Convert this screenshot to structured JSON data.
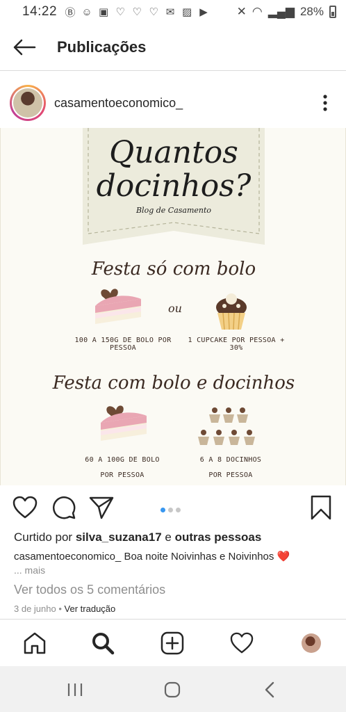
{
  "status_bar": {
    "time": "14:22",
    "battery": "28%",
    "icons": [
      "b-icon",
      "chat-icon",
      "facebook-icon",
      "heart-icon",
      "heart-icon",
      "heart-icon",
      "mail-icon",
      "image-icon",
      "youtube-icon"
    ]
  },
  "header": {
    "title": "Publicações"
  },
  "post": {
    "username": "casamentoeconomico_",
    "image": {
      "title_line1": "Quantos",
      "title_line2": "docinhos?",
      "subtitle": "Blog de Casamento",
      "section1_title": "Festa só com bolo",
      "or_label": "ou",
      "section1_left_caption": "100 A 150G DE BOLO POR PESSOA",
      "section1_right_caption": "1 CUPCAKE POR PESSOA + 30%",
      "section2_title": "Festa com bolo e docinhos",
      "section2_left_caption_1": "60 A 100G DE BOLO",
      "section2_left_caption_2": "POR PESSOA",
      "section2_right_caption_1": "6 A 8 DOCINHOS",
      "section2_right_caption_2": "POR PESSOA"
    },
    "carousel_count": 3,
    "carousel_active": 0,
    "likes_prefix": "Curtido por",
    "likes_user": "silva_suzana17",
    "likes_and": "e",
    "likes_others": "outras pessoas",
    "caption_user": "casamentoeconomico_",
    "caption_text": "Boa noite Noivinhas e Noivinhos",
    "caption_emoji": "❤️",
    "more_label": "... mais",
    "view_comments": "Ver todos os 5 comentários",
    "date": "3 de junho",
    "separator": "•",
    "translate_label": "Ver tradução"
  },
  "colors": {
    "accent": "#3897f0",
    "text": "#262626",
    "muted": "#8e8e8e",
    "heart": "#e0245e"
  }
}
